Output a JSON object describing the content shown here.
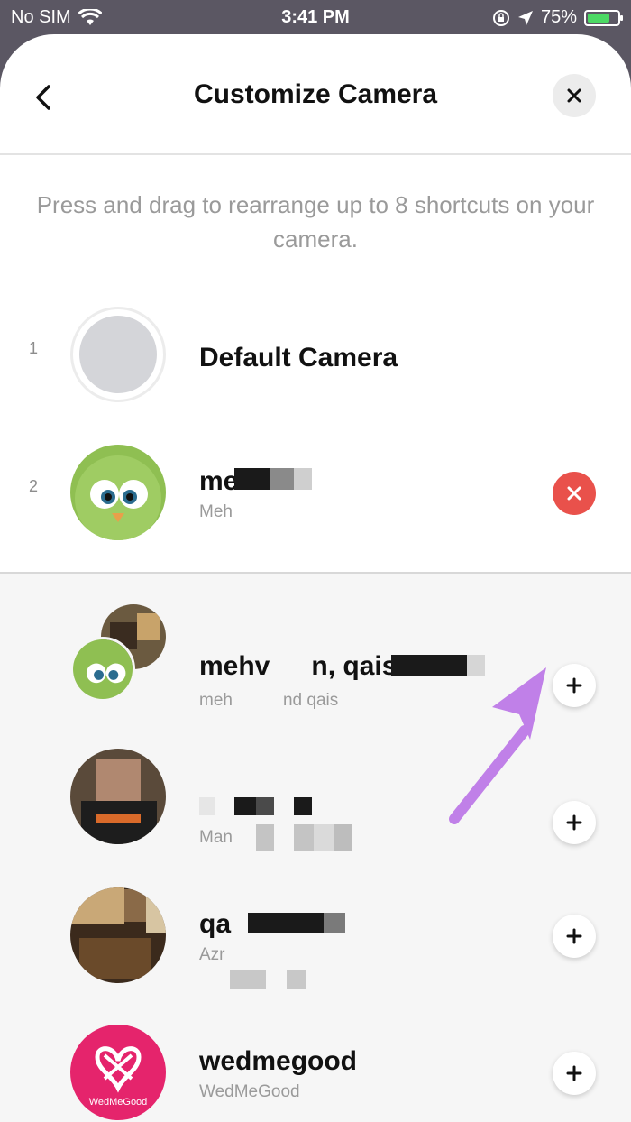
{
  "status": {
    "carrier": "No SIM",
    "time": "3:41 PM",
    "battery": "75%",
    "battery_level": 0.75
  },
  "header": {
    "title": "Customize Camera"
  },
  "instructions": "Press and drag to rearrange up to 8 shortcuts on your camera.",
  "selected": [
    {
      "index": "1",
      "name": "Default Camera"
    },
    {
      "index": "2",
      "name": "me",
      "subtitle": "Meh"
    }
  ],
  "suggestions": [
    {
      "name": "mehv",
      "name_tail": "n, qais",
      "subtitle": "meh",
      "subtitle_tail": "nd qais"
    },
    {
      "name": "",
      "subtitle": "Man"
    },
    {
      "name": "qa",
      "subtitle": "Azr"
    },
    {
      "name": "wedmegood",
      "subtitle": "WedMeGood",
      "logo_text": "WedMeGood"
    }
  ],
  "colors": {
    "remove": "#e9514b",
    "arrow": "#c080e8",
    "wedmegood": "#e5246c"
  },
  "icons": [
    "wifi-icon",
    "location-icon",
    "lock-rotation-icon",
    "back-chevron-icon",
    "close-icon",
    "remove-icon",
    "add-icon"
  ]
}
